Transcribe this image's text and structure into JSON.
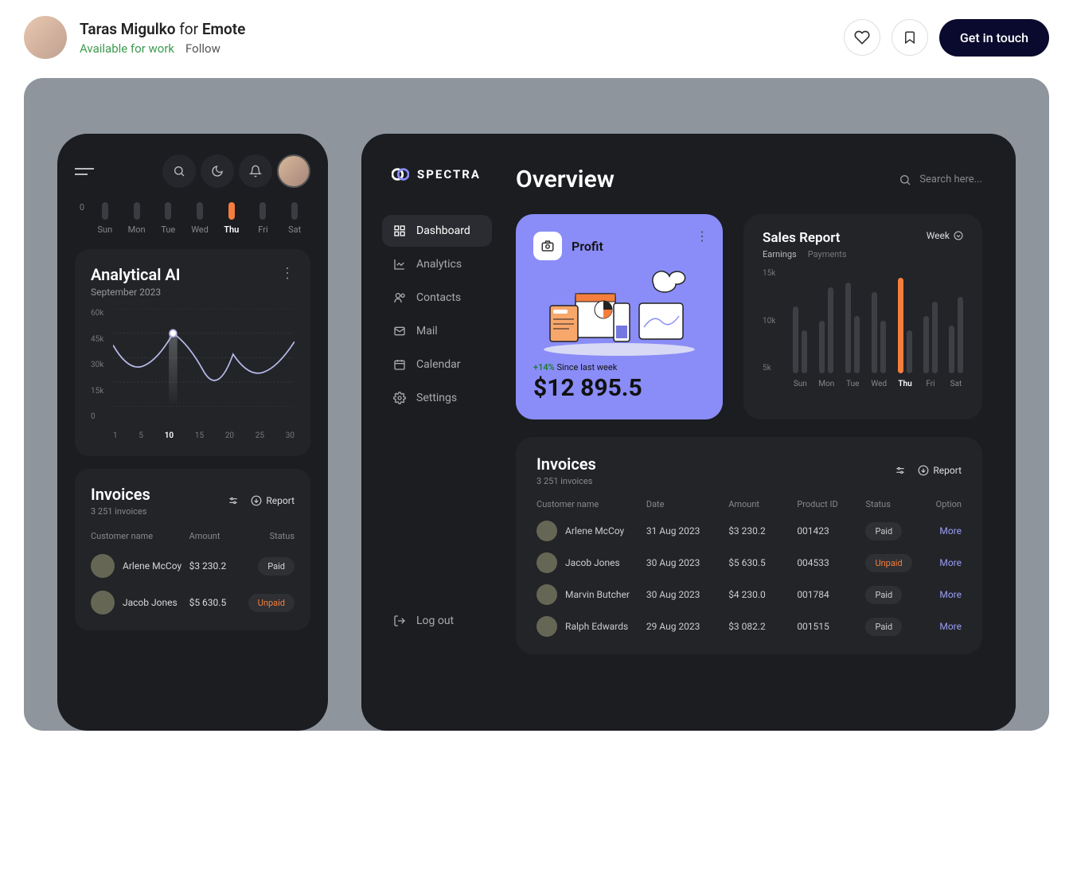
{
  "header": {
    "author": "Taras Migulko",
    "for_word": "for",
    "brand": "Emote",
    "available": "Available for work",
    "follow": "Follow",
    "cta": "Get in touch"
  },
  "mobile": {
    "week_zero": "0",
    "days": [
      "Sun",
      "Mon",
      "Tue",
      "Wed",
      "Thu",
      "Fri",
      "Sat"
    ],
    "active_day_index": 4,
    "analytical": {
      "title": "Analytical AI",
      "subtitle": "September 2023"
    },
    "invoices": {
      "title": "Invoices",
      "subtitle": "3 251 invoices",
      "report": "Report",
      "cols": [
        "Customer name",
        "Amount",
        "Status"
      ],
      "rows": [
        {
          "name": "Arlene McCoy",
          "amount": "$3 230.2",
          "status": "Paid"
        },
        {
          "name": "Jacob Jones",
          "amount": "$5 630.5",
          "status": "Unpaid"
        }
      ]
    }
  },
  "chart_data": {
    "type": "line",
    "title": "Analytical AI",
    "x": [
      1,
      5,
      10,
      15,
      20,
      25,
      30
    ],
    "values": [
      38,
      25,
      45,
      22,
      32,
      21,
      40
    ],
    "ylabel": "",
    "ylim": [
      0,
      60
    ],
    "yticks": [
      "60k",
      "45k",
      "30k",
      "15k",
      "0"
    ],
    "xticks": [
      "1",
      "5",
      "10",
      "15",
      "20",
      "25",
      "30"
    ],
    "highlight_x_index": 2
  },
  "desktop": {
    "logo": "SPECTRA",
    "nav": [
      {
        "icon": "grid",
        "label": "Dashboard",
        "active": true
      },
      {
        "icon": "chart",
        "label": "Analytics"
      },
      {
        "icon": "users",
        "label": "Contacts"
      },
      {
        "icon": "mail",
        "label": "Mail"
      },
      {
        "icon": "calendar",
        "label": "Calendar"
      },
      {
        "icon": "gear",
        "label": "Settings"
      }
    ],
    "logout": "Log out",
    "page_title": "Overview",
    "search_placeholder": "Search here...",
    "profit": {
      "label": "Profit",
      "delta_pct": "+14%",
      "delta_text": "Since last week",
      "value": "$12 895.5"
    },
    "sales": {
      "title": "Sales Report",
      "tab1": "Earnings",
      "tab2": "Payments",
      "period": "Week",
      "yticks": [
        "15k",
        "10k",
        "5k"
      ],
      "days": [
        "Sun",
        "Mon",
        "Tue",
        "Wed",
        "Thu",
        "Fri",
        "Sat"
      ],
      "active_index": 4,
      "bars": [
        {
          "a": 70,
          "b": 45
        },
        {
          "a": 55,
          "b": 90
        },
        {
          "a": 95,
          "b": 60
        },
        {
          "a": 85,
          "b": 55
        },
        {
          "a": 100,
          "b": 45
        },
        {
          "a": 60,
          "b": 75
        },
        {
          "a": 50,
          "b": 80
        }
      ]
    },
    "invoices": {
      "title": "Invoices",
      "subtitle": "3 251 invoices",
      "report": "Report",
      "cols": [
        "Customer name",
        "Date",
        "Amount",
        "Product ID",
        "Status",
        "Option"
      ],
      "rows": [
        {
          "name": "Arlene McCoy",
          "date": "31 Aug 2023",
          "amount": "$3 230.2",
          "product": "001423",
          "status": "Paid",
          "more": "More"
        },
        {
          "name": "Jacob Jones",
          "date": "30 Aug 2023",
          "amount": "$5 630.5",
          "product": "004533",
          "status": "Unpaid",
          "more": "More"
        },
        {
          "name": "Marvin Butcher",
          "date": "30 Aug 2023",
          "amount": "$4 230.0",
          "product": "001784",
          "status": "Paid",
          "more": "More"
        },
        {
          "name": "Ralph Edwards",
          "date": "29 Aug 2023",
          "amount": "$3 082.2",
          "product": "001515",
          "status": "Paid",
          "more": "More"
        }
      ]
    }
  }
}
